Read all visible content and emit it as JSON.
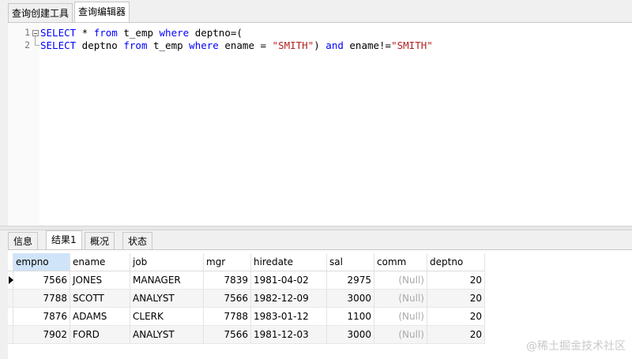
{
  "top_tabs": [
    {
      "label": "查询创建工具",
      "active": false
    },
    {
      "label": "查询编辑器",
      "active": true
    }
  ],
  "editor": {
    "lines": [
      {
        "num": "1",
        "segments": [
          {
            "t": "SELECT",
            "c": "kw"
          },
          {
            "t": " * ",
            "c": "op"
          },
          {
            "t": "from",
            "c": "kw"
          },
          {
            "t": " t_emp ",
            "c": "op"
          },
          {
            "t": "where",
            "c": "kw"
          },
          {
            "t": " deptno=(",
            "c": "op"
          }
        ]
      },
      {
        "num": "2",
        "segments": [
          {
            "t": "SELECT",
            "c": "kw"
          },
          {
            "t": " deptno ",
            "c": "op"
          },
          {
            "t": "from",
            "c": "kw"
          },
          {
            "t": " t_emp ",
            "c": "op"
          },
          {
            "t": "where",
            "c": "kw"
          },
          {
            "t": " ename = ",
            "c": "op"
          },
          {
            "t": "\"SMITH\"",
            "c": "str"
          },
          {
            "t": ") ",
            "c": "op"
          },
          {
            "t": "and",
            "c": "kw"
          },
          {
            "t": " ename!=",
            "c": "op"
          },
          {
            "t": "\"SMITH\"",
            "c": "str"
          }
        ]
      }
    ]
  },
  "result_tabs": [
    {
      "label": "信息",
      "active": false
    },
    {
      "label": "结果1",
      "active": true
    },
    {
      "label": "概况",
      "active": false
    },
    {
      "label": "状态",
      "active": false
    }
  ],
  "grid": {
    "columns": [
      "empno",
      "ename",
      "job",
      "mgr",
      "hiredate",
      "sal",
      "comm",
      "deptno"
    ],
    "rows": [
      [
        "7566",
        "JONES",
        "MANAGER",
        "7839",
        "1981-04-02",
        "2975",
        "(Null)",
        "20"
      ],
      [
        "7788",
        "SCOTT",
        "ANALYST",
        "7566",
        "1982-12-09",
        "3000",
        "(Null)",
        "20"
      ],
      [
        "7876",
        "ADAMS",
        "CLERK",
        "7788",
        "1983-01-12",
        "1100",
        "(Null)",
        "20"
      ],
      [
        "7902",
        "FORD",
        "ANALYST",
        "7566",
        "1981-12-03",
        "3000",
        "(Null)",
        "20"
      ]
    ]
  },
  "watermark": "@稀土掘金技术社区"
}
